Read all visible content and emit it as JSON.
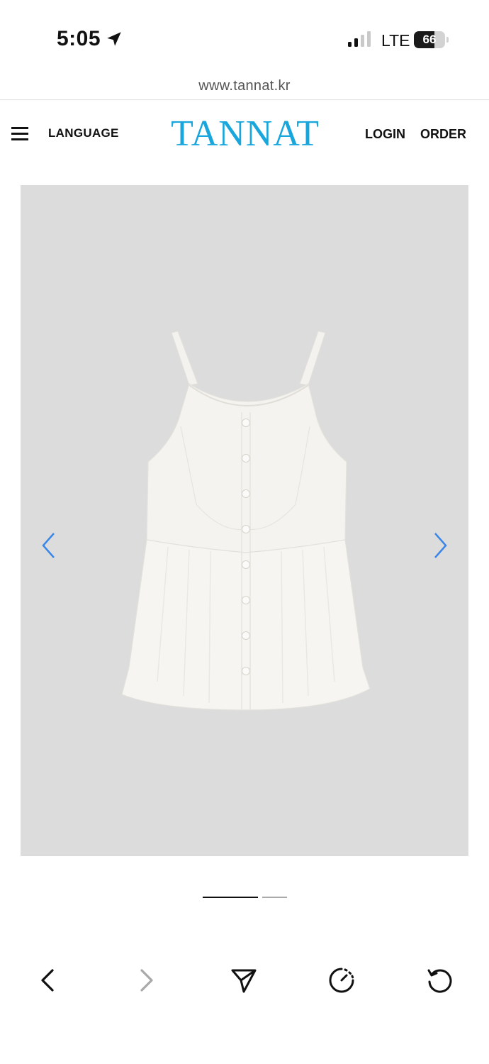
{
  "status_bar": {
    "time": "5:05",
    "network": "LTE",
    "battery_level": "66",
    "battery_fraction": 0.66
  },
  "browser": {
    "url": "www.tannat.kr"
  },
  "header": {
    "language_label": "LANGUAGE",
    "logo": "TANNAT",
    "login_label": "LOGIN",
    "order_label": "ORDER",
    "logo_color": "#19a6dc"
  },
  "gallery": {
    "current_slide": 1,
    "slide_count": 2,
    "arrow_color": "#3a86e8"
  },
  "toolbar": {
    "icons": [
      "back-icon",
      "forward-icon",
      "share-icon",
      "timer-icon",
      "reload-icon"
    ]
  }
}
